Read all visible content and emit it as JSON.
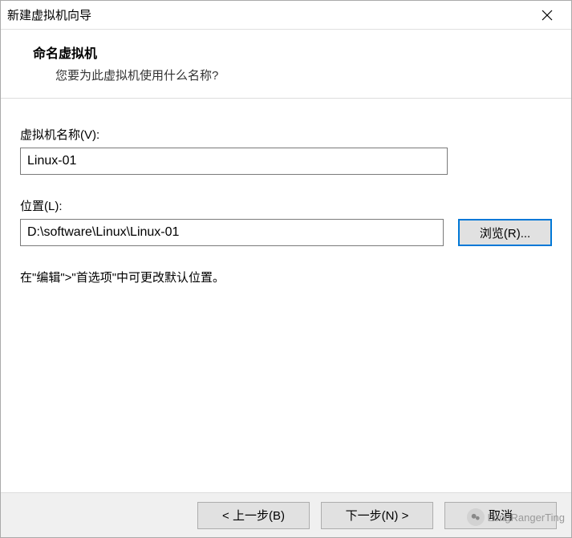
{
  "window": {
    "title": "新建虚拟机向导"
  },
  "header": {
    "title": "命名虚拟机",
    "subtitle": "您要为此虚拟机使用什么名称?"
  },
  "fields": {
    "name": {
      "label": "虚拟机名称(V):",
      "value": "Linux-01"
    },
    "location": {
      "label": "位置(L):",
      "value": "D:\\software\\Linux\\Linux-01",
      "browse_label": "浏览(R)..."
    },
    "hint": "在\"编辑\">\"首选项\"中可更改默认位置。"
  },
  "footer": {
    "back_label": "< 上一步(B)",
    "next_label": "下一步(N) >",
    "cancel_label": "取消"
  },
  "watermark": "LongRangerTing"
}
